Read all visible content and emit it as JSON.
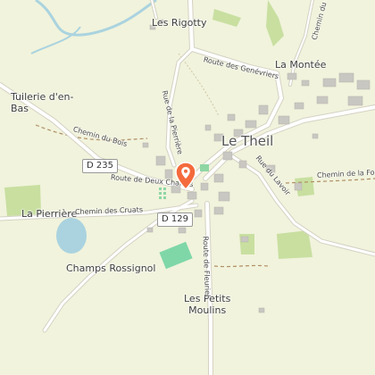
{
  "map": {
    "places": {
      "les_rigotty": "Les Rigotty",
      "la_montee": "La Montée",
      "tuilerie": "Tuilerie d'en-\nBas",
      "le_theil": "Le Theil",
      "la_pierriere": "La Pierrière",
      "champs_rossignol": "Champs Rossignol",
      "les_petits_moulins": "Les Petits\nMoulins"
    },
    "roads": {
      "route_genevriers": "Route des Genévriers",
      "rue_pierriere": "Rue de la Pierrière",
      "chemin_bois": "Chemin du Bois",
      "route_deux_chaises": "Route de Deux Chaises",
      "chemin_cruats": "Chemin des Cruats",
      "route_fleuriel": "Route de Fleuriel",
      "rue_lavoir": "Rue du Lavoir",
      "chemin_fon": "Chemin de la Fon",
      "chemin_top": "Chemin du Ch"
    },
    "shields": {
      "d235": "D 235",
      "d129": "D 129"
    },
    "colors": {
      "background": "#f1f3dc",
      "road": "#ffffff",
      "road_casing": "#d5d1c4",
      "building": "#c9c7c1",
      "water": "#aad3df",
      "green": "#c8dfa0",
      "sport": "#7fd7a8",
      "path": "#b08f66",
      "marker": "#f46a3c"
    },
    "marker_icon": "map-pin-icon"
  }
}
